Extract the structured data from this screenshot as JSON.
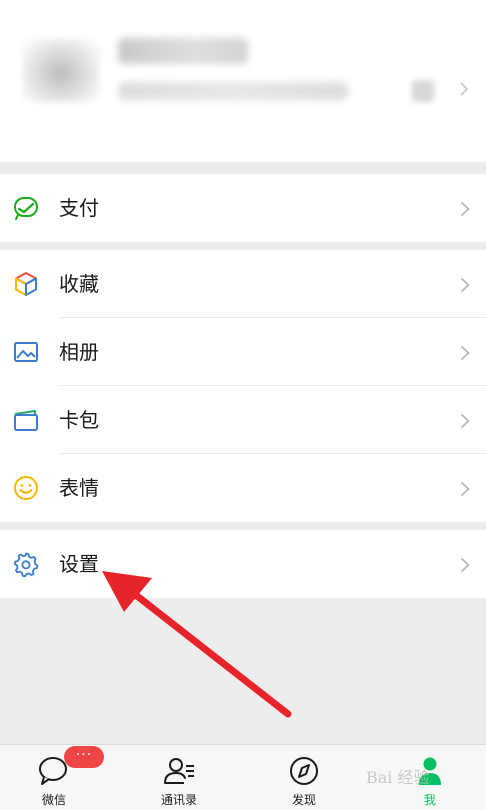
{
  "menu": {
    "pay": "支付",
    "favorites": "收藏",
    "album": "相册",
    "cards": "卡包",
    "stickers": "表情",
    "settings": "设置"
  },
  "tabbar": {
    "chats": "微信",
    "contacts": "通讯录",
    "discover": "发现",
    "me": "我",
    "chats_badge": "···"
  },
  "watermark": "Bai 经验",
  "colors": {
    "accent_green": "#07c160",
    "pay_green": "#1aad19",
    "settings_blue": "#3b7ed0",
    "badge_red": "#f04545",
    "annotation_red": "#e8242b"
  }
}
